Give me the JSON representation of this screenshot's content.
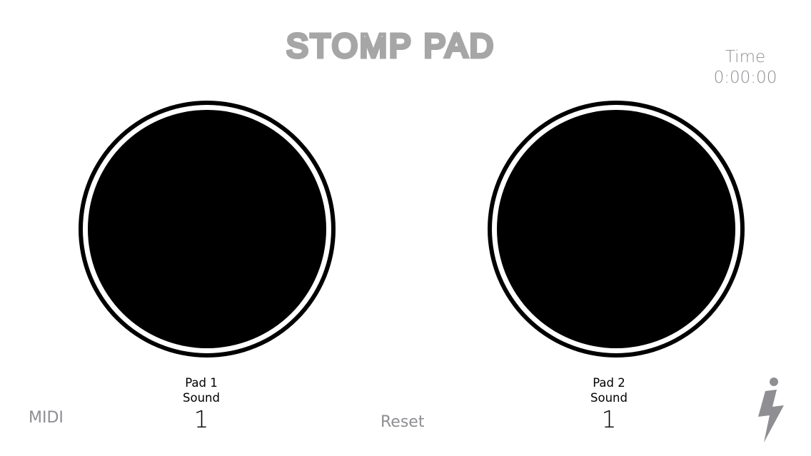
{
  "app": {
    "title": "STOMP PAD"
  },
  "time": {
    "label": "Time",
    "value": "0:00:00"
  },
  "pads": [
    {
      "name_line1": "Pad 1",
      "name_line2": "Sound",
      "sound_number": "1"
    },
    {
      "name_line1": "Pad 2",
      "name_line2": "Sound",
      "sound_number": "1"
    }
  ],
  "footer": {
    "midi_label": "MIDI",
    "reset_label": "Reset"
  },
  "icons": {
    "info": "info-lightning-icon"
  },
  "colors": {
    "title": "#a6a6a6",
    "secondary_text": "#8e8e93",
    "pad": "#000000",
    "background": "#ffffff"
  }
}
